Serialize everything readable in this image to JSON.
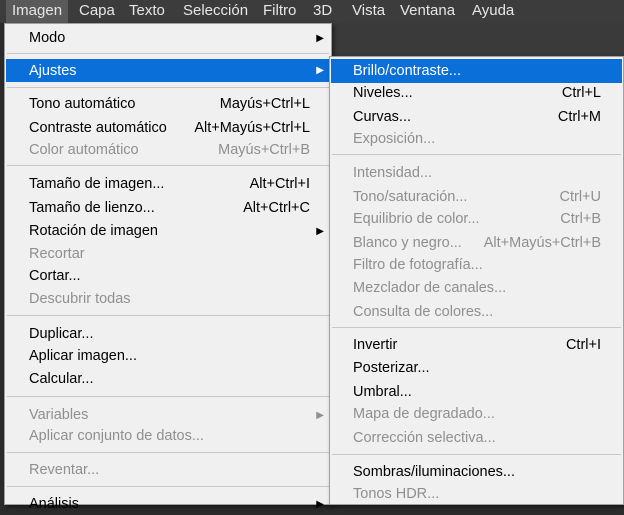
{
  "menubar": {
    "items": [
      "Imagen",
      "Capa",
      "Texto",
      "Selección",
      "Filtro",
      "3D",
      "Vista",
      "Ventana",
      "Ayuda"
    ]
  },
  "main_menu": {
    "modo": "Modo",
    "ajustes": "Ajustes",
    "tono_auto": "Tono automático",
    "tono_auto_sc": "Mayús+Ctrl+L",
    "contraste_auto": "Contraste automático",
    "contraste_auto_sc": "Alt+Mayús+Ctrl+L",
    "color_auto": "Color automático",
    "color_auto_sc": "Mayús+Ctrl+B",
    "tam_imagen": "Tamaño de imagen...",
    "tam_imagen_sc": "Alt+Ctrl+I",
    "tam_lienzo": "Tamaño de lienzo...",
    "tam_lienzo_sc": "Alt+Ctrl+C",
    "rotacion": "Rotación de imagen",
    "recortar": "Recortar",
    "cortar": "Cortar...",
    "descubrir": "Descubrir todas",
    "duplicar": "Duplicar...",
    "aplicar_imagen": "Aplicar imagen...",
    "calcular": "Calcular...",
    "variables": "Variables",
    "aplicar_conjunto": "Aplicar conjunto de datos...",
    "reventar": "Reventar...",
    "analisis": "Análisis"
  },
  "sub_menu": {
    "brillo": "Brillo/contraste...",
    "niveles": "Niveles...",
    "niveles_sc": "Ctrl+L",
    "curvas": "Curvas...",
    "curvas_sc": "Ctrl+M",
    "exposicion": "Exposición...",
    "intensidad": "Intensidad...",
    "tono_sat": "Tono/saturación...",
    "tono_sat_sc": "Ctrl+U",
    "equilibrio": "Equilibrio de color...",
    "equilibrio_sc": "Ctrl+B",
    "blanco_negro": "Blanco y negro...",
    "blanco_negro_sc": "Alt+Mayús+Ctrl+B",
    "filtro_foto": "Filtro de fotografía...",
    "mezclador": "Mezclador de canales...",
    "consulta": "Consulta de colores...",
    "invertir": "Invertir",
    "invertir_sc": "Ctrl+I",
    "posterizar": "Posterizar...",
    "umbral": "Umbral...",
    "mapa": "Mapa de degradado...",
    "correccion": "Corrección selectiva...",
    "sombras": "Sombras/iluminaciones...",
    "tonos_hdr": "Tonos HDR..."
  },
  "colors": {
    "highlight": "#0a6fd9",
    "menu_bg": "#f0f0f0",
    "menubar_bg": "#3c3c3c",
    "disabled_text": "#8f8f8f"
  }
}
